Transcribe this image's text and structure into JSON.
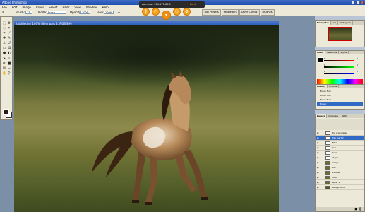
{
  "app": {
    "title": "Adobe Photoshop"
  },
  "menu": [
    "File",
    "Edit",
    "Image",
    "Layer",
    "Select",
    "Filter",
    "View",
    "Window",
    "Help"
  ],
  "options": {
    "brush_label": "Brush:",
    "brush_size": "17",
    "mode_label": "Mode:",
    "mode_value": "Brush",
    "opacity_label": "Opacity:",
    "opacity_value": "100%",
    "flow_label": "Flow:",
    "flow_value": "100%"
  },
  "palette_well": [
    "Tool Presets",
    "Paragraph",
    "Layer Comps",
    "Brushes"
  ],
  "capture_bar": {
    "left": "com.mac 104.177.63.3",
    "right": "Bank"
  },
  "document": {
    "title": "Untitled @ 100% (filler part 2, RGB/8#)"
  },
  "navigator": {
    "tabs": [
      "Navigator",
      "Info",
      "Histogram"
    ]
  },
  "color_panel": {
    "tabs": [
      "Color",
      "Swatches",
      "Styles"
    ],
    "r": "0",
    "g": "0",
    "b": "0"
  },
  "history": {
    "tabs": [
      "History",
      "Actions"
    ],
    "items": [
      "Brush Tool",
      "Brush Tool",
      "Brush Tool",
      "Eraser"
    ]
  },
  "layers": {
    "tabs": [
      "Layers",
      "Channels",
      "Paths"
    ],
    "items": [
      "the crazy later",
      "filler part 2",
      "filter",
      "hair",
      "hairs",
      "shape",
      "merge",
      "blur",
      "shadow",
      "color",
      "Layer 1",
      "Background"
    ]
  },
  "colors": {
    "accent": "#f4a21c",
    "selection": "#316ac5",
    "titlebar": "#2a5bb8"
  }
}
